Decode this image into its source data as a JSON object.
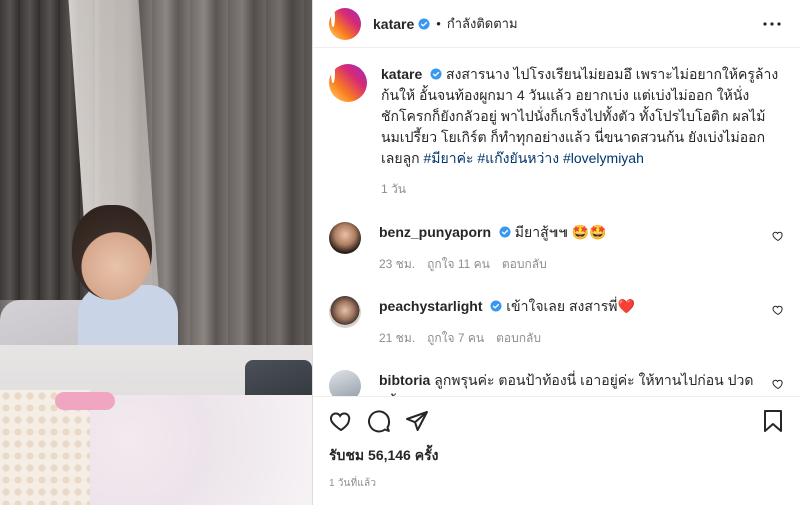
{
  "post": {
    "header": {
      "username": "katare",
      "follow_label": "กำลังติดตาม"
    },
    "caption": {
      "username": "katare",
      "text": " สงสารนาง ไปโรงเรียนไม่ยอมอึ เพราะไม่อยากให้ครูล้างก้นให้ อั้นจนท้องผูกมา 4 วันแล้ว อยากเบ่ง แต่เบ่งไม่ออก ให้นั่งชักโครกก็ยังกลัวอยู่ พาไปนั่งก็เกร็งไปทั้งตัว ทั้งโปรไบโอติก ผลไม้ นมเปรี้ยว โยเกิร์ต ก็ทำทุกอย่างแล้ว นี่ขนาดสวนก้น ยังเบ่งไม่ออกเลยลูก ",
      "tags": [
        "#มียาค่ะ",
        "#แก๊งยันหว่าง",
        "#lovelymiyah"
      ],
      "time": "1 วัน"
    },
    "comments": [
      {
        "username": "benz_punyaporn",
        "text": " มียาสู้๚๚ 🤩🤩",
        "time": "23 ชม.",
        "likes": "ถูกใจ 11 คน",
        "reply": "ตอบกลับ"
      },
      {
        "username": "peachystarlight",
        "text": " เข้าใจเลย สงสารพี่❤️",
        "time": "21 ชม.",
        "likes": "ถูกใจ 7 คน",
        "reply": "ตอบกลับ"
      },
      {
        "username": "bibtoria",
        "text": " ลูกพรุนค่ะ ตอนป้าท้องนี่ เอาอยู่ค่ะ ให้ทานไปก่อน ปวดแล้ว"
      }
    ],
    "likes_text": "รับชม 56,146 ครั้ง",
    "date_text": "1 วันที่แล้ว"
  },
  "icons": {
    "verified_color": "#3897f0",
    "link_color": "#00376b"
  }
}
